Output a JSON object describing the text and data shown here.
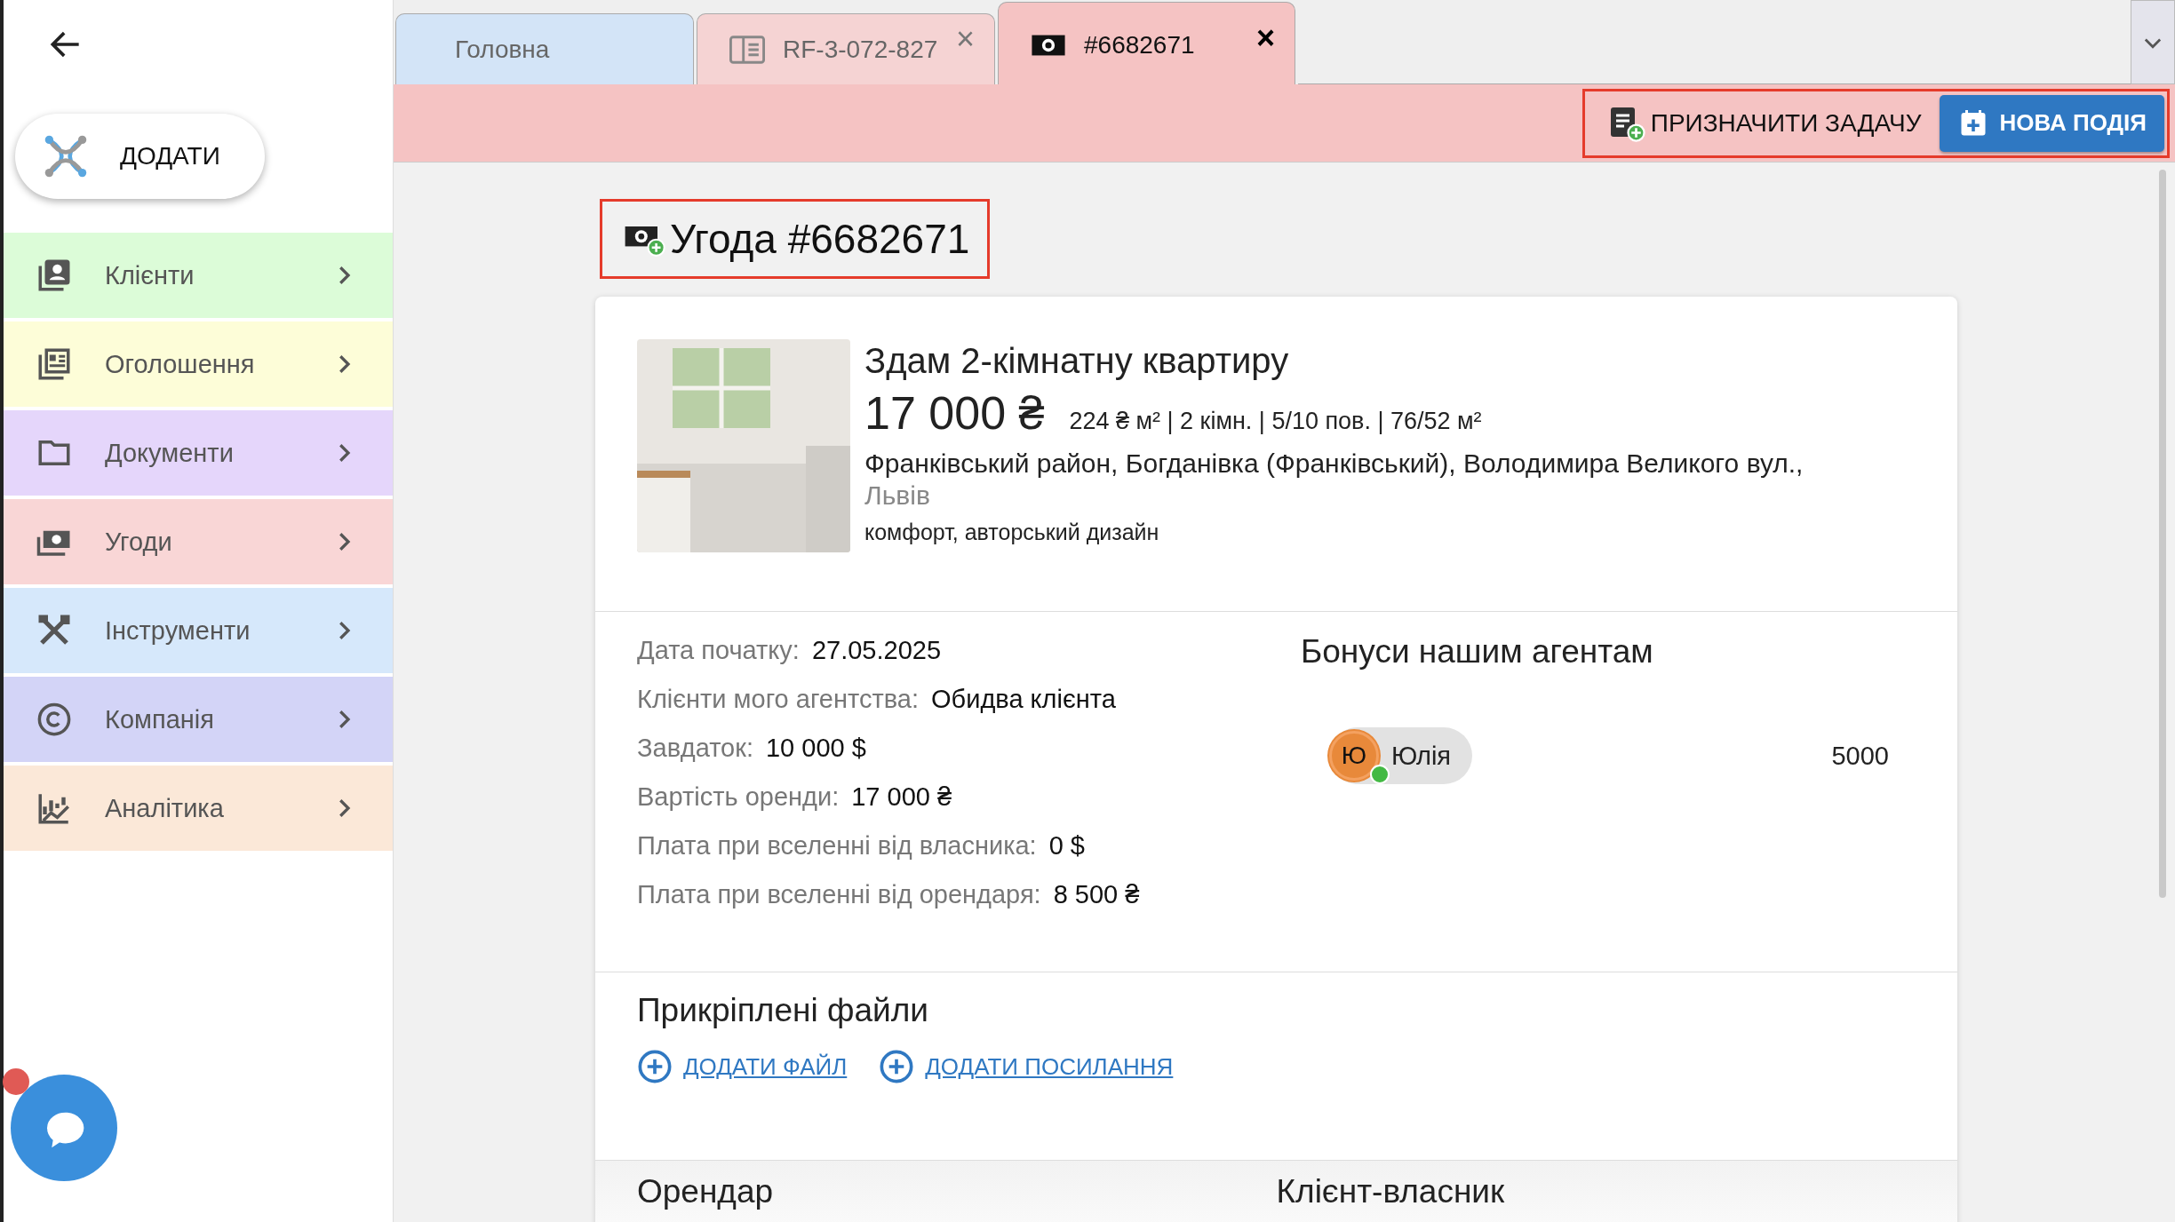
{
  "tabs": [
    {
      "label": "Головна",
      "kind": "home",
      "selected": false
    },
    {
      "label": "RF-3-072-827",
      "kind": "listing",
      "selected": false,
      "close": "×"
    },
    {
      "label": "#6682671",
      "kind": "deal",
      "selected": true,
      "close": "×"
    }
  ],
  "toolbar": {
    "buttons": [
      {
        "label": "ПРИЗНАЧИТИ ЗАДАЧУ",
        "kind": "task"
      },
      {
        "label": "НОВА ПОДІЯ",
        "kind": "event"
      }
    ]
  },
  "sidebar": {
    "add_button": "ДОДАТИ",
    "items": [
      {
        "label": "Клієнти",
        "color": "#dcfcd8"
      },
      {
        "label": "Оголошення",
        "color": "#fdfdd8"
      },
      {
        "label": "Документи",
        "color": "#e5d6fb"
      },
      {
        "label": "Угоди",
        "color": "#f9d6d6"
      },
      {
        "label": "Інструменти",
        "color": "#d6e8fb"
      },
      {
        "label": "Компанія",
        "color": "#d3d4f7"
      },
      {
        "label": "Аналітика",
        "color": "#fbe8d8"
      }
    ]
  },
  "deal": {
    "title": "Угода #6682671",
    "listing": {
      "title": "Здам 2-кімнатну квартиру",
      "price": "17 000 ₴",
      "meta": "224 ₴ м² | 2 кімн. | 5/10 пов. | 76/52 м²",
      "address": "Франківський район, Богданівка (Франківський), Володимира Великого вул.,",
      "city": "Львів",
      "tags": "комфорт, авторський дизайн"
    },
    "details": [
      {
        "label": "Дата початку:",
        "value": "27.05.2025"
      },
      {
        "label": "Клієнти мого агентства:",
        "value": "Обидва клієнта"
      },
      {
        "label": "Завдаток:",
        "value": "10 000 $"
      },
      {
        "label": "Вартість оренди:",
        "value": "17 000 ₴"
      },
      {
        "label": "Плата при вселенні від власника:",
        "value": "0 $"
      },
      {
        "label": "Плата при вселенні від орендаря:",
        "value": "8 500 ₴"
      }
    ],
    "bonuses": {
      "title": "Бонуси нашим агентам",
      "agents": [
        {
          "initial": "Ю",
          "name": "Юлія",
          "amount": "5000",
          "online": true
        }
      ]
    },
    "files": {
      "title": "Прикріплені файли",
      "actions": [
        "ДОДАТИ ФАЙЛ",
        "ДОДАТИ ПОСИЛАННЯ"
      ]
    },
    "parties": [
      "Орендар",
      "Клієнт-власник"
    ]
  }
}
